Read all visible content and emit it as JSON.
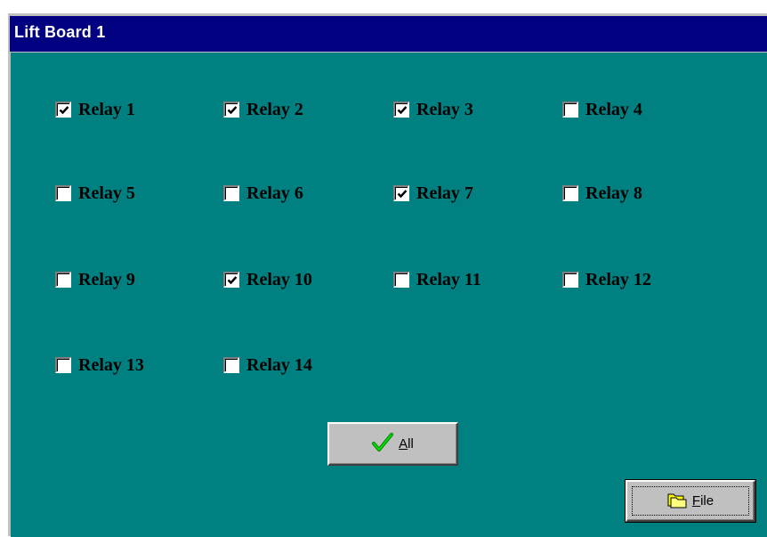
{
  "window": {
    "title": "Lift Board 1"
  },
  "relays": [
    {
      "label": "Relay 1",
      "checked": true
    },
    {
      "label": "Relay 2",
      "checked": true
    },
    {
      "label": "Relay 3",
      "checked": true
    },
    {
      "label": "Relay 4",
      "checked": false
    },
    {
      "label": "Relay 5",
      "checked": false
    },
    {
      "label": "Relay 6",
      "checked": false
    },
    {
      "label": "Relay 7",
      "checked": true
    },
    {
      "label": "Relay 8",
      "checked": false
    },
    {
      "label": "Relay 9",
      "checked": false
    },
    {
      "label": "Relay 10",
      "checked": true
    },
    {
      "label": "Relay 11",
      "checked": false
    },
    {
      "label": "Relay 12",
      "checked": false
    },
    {
      "label": "Relay 13",
      "checked": false
    },
    {
      "label": "Relay 14",
      "checked": false
    }
  ],
  "buttons": {
    "all_label": "All",
    "all_icon": "green-checkmark-icon",
    "file_label": "File",
    "file_icon": "folder-icon"
  },
  "colors": {
    "titlebar": "#000080",
    "background": "#008080",
    "checkmark_green": "#00c000"
  }
}
